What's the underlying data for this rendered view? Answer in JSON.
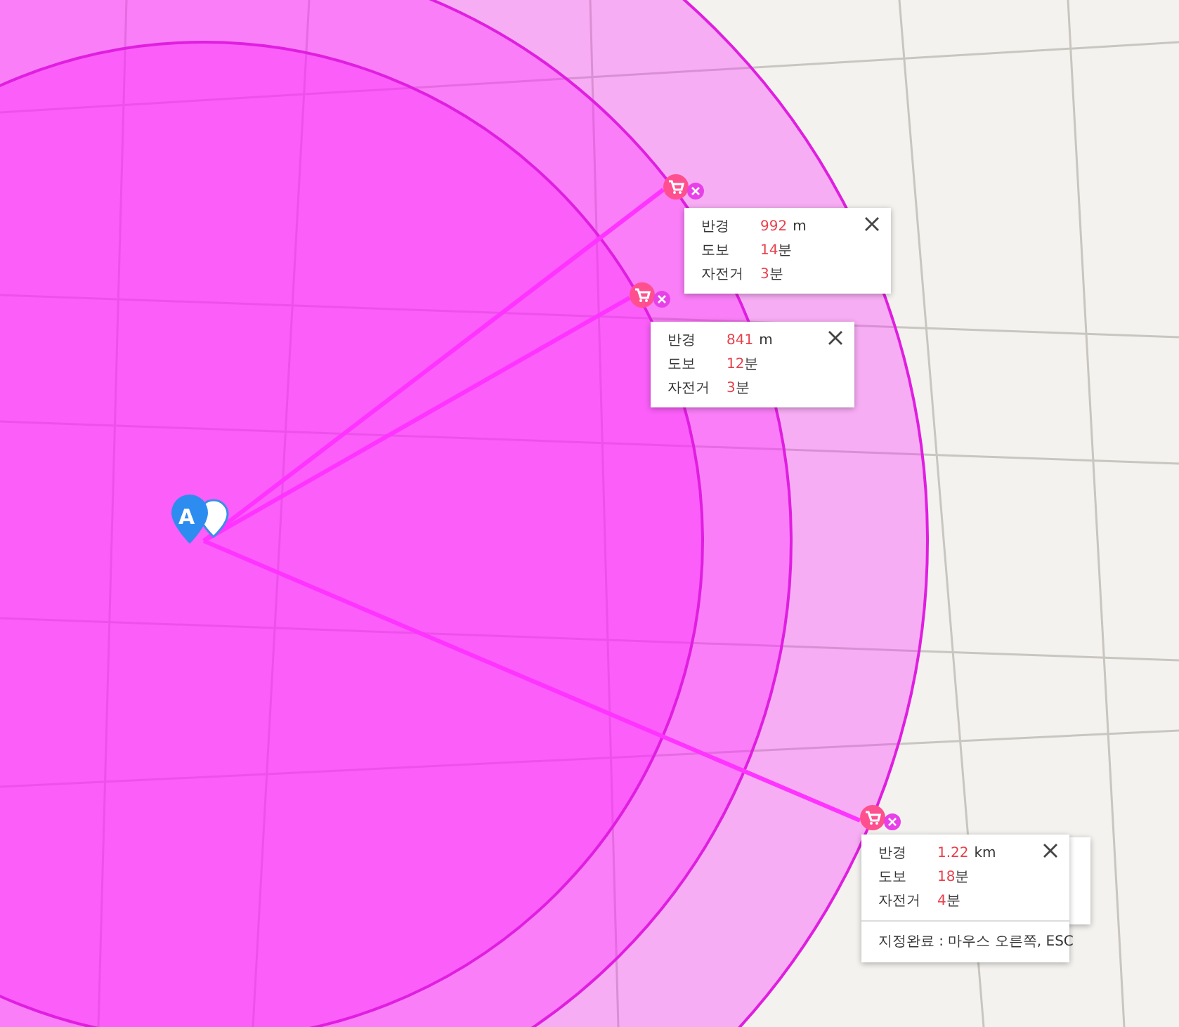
{
  "origin_marker": {
    "label": "A"
  },
  "stores": [
    {
      "info": {
        "rows": [
          {
            "label": "반경",
            "value": "992",
            "unit": "m"
          },
          {
            "label": "도보",
            "value": "14",
            "unit": "분"
          },
          {
            "label": "자전거",
            "value": "3",
            "unit": "분"
          }
        ]
      }
    },
    {
      "info": {
        "rows": [
          {
            "label": "반경",
            "value": "841",
            "unit": "m"
          },
          {
            "label": "도보",
            "value": "12",
            "unit": "분"
          },
          {
            "label": "자전거",
            "value": "3",
            "unit": "분"
          }
        ]
      }
    },
    {
      "info": {
        "rows": [
          {
            "label": "반경",
            "value": "1.22",
            "unit": "km"
          },
          {
            "label": "도보",
            "value": "18",
            "unit": "분"
          },
          {
            "label": "자전거",
            "value": "4",
            "unit": "분"
          }
        ],
        "hint": "지정완료 : 마우스 오른쪽, ESC"
      }
    }
  ]
}
